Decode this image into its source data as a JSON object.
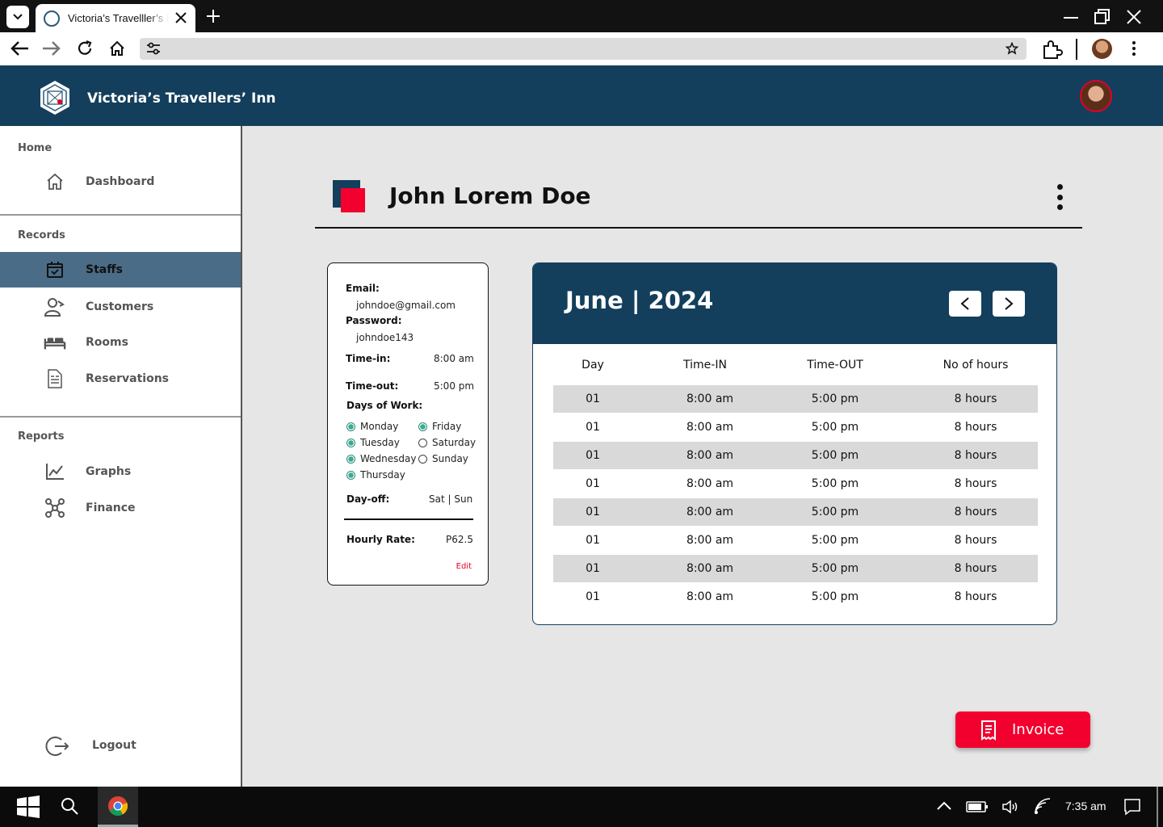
{
  "browser": {
    "tab_title": "Victoria’s Travelller’s Inn",
    "address": ""
  },
  "app": {
    "brand": "Victoria’s Travellers’ Inn"
  },
  "sidebar": {
    "sections": {
      "home": "Home",
      "records": "Records",
      "reports": "Reports"
    },
    "items": [
      {
        "label": "Dashboard",
        "icon": "home-icon"
      },
      {
        "label": "Staffs",
        "icon": "calendar-check-icon",
        "active": true
      },
      {
        "label": "Customers",
        "icon": "customers-icon"
      },
      {
        "label": "Rooms",
        "icon": "bed-icon"
      },
      {
        "label": "Reservations",
        "icon": "document-icon"
      },
      {
        "label": "Graphs",
        "icon": "line-chart-icon"
      },
      {
        "label": "Finance",
        "icon": "network-icon"
      }
    ],
    "logout": "Logout"
  },
  "page": {
    "title": "John Lorem Doe"
  },
  "staff": {
    "email_label": "Email:",
    "email": "johndoe@gmail.com",
    "password_label": "Password:",
    "password": "johndoe143",
    "time_in_label": "Time-in:",
    "time_in": "8:00 am",
    "time_out_label": "Time-out:",
    "time_out": "5:00 pm",
    "days_label": "Days of Work:",
    "days": [
      {
        "name": "Monday",
        "checked": true
      },
      {
        "name": "Tuesday",
        "checked": true
      },
      {
        "name": "Wednesday",
        "checked": true
      },
      {
        "name": "Thursday",
        "checked": true
      },
      {
        "name": "Friday",
        "checked": true
      },
      {
        "name": "Saturday",
        "checked": false
      },
      {
        "name": "Sunday",
        "checked": false
      }
    ],
    "dayoff_label": "Day-off:",
    "dayoff": "Sat | Sun",
    "rate_label": "Hourly Rate:",
    "rate": "P62.5",
    "edit": "Edit"
  },
  "calendar": {
    "title": "June | 2024",
    "prev": "<",
    "next": ">",
    "headers": [
      "Day",
      "Time-IN",
      "Time-OUT",
      "No of hours"
    ],
    "rows": [
      [
        "01",
        "8:00 am",
        "5:00 pm",
        "8 hours"
      ],
      [
        "01",
        "8:00 am",
        "5:00 pm",
        "8 hours"
      ],
      [
        "01",
        "8:00 am",
        "5:00 pm",
        "8 hours"
      ],
      [
        "01",
        "8:00 am",
        "5:00 pm",
        "8 hours"
      ],
      [
        "01",
        "8:00 am",
        "5:00 pm",
        "8 hours"
      ],
      [
        "01",
        "8:00 am",
        "5:00 pm",
        "8 hours"
      ],
      [
        "01",
        "8:00 am",
        "5:00 pm",
        "8 hours"
      ],
      [
        "01",
        "8:00 am",
        "5:00 pm",
        "8 hours"
      ]
    ]
  },
  "invoice": "Invoice",
  "taskbar": {
    "time": "7:35 am"
  },
  "colors": {
    "primary": "#133f5c",
    "accent": "#f2002e",
    "active_nav": "#4a6c87"
  }
}
